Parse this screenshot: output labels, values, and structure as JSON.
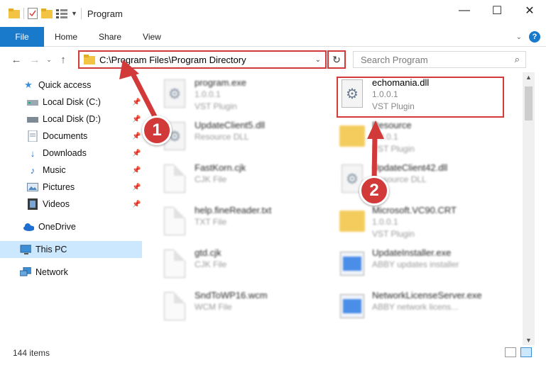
{
  "window": {
    "title": "Program",
    "minimize": "—",
    "maximize": "☐",
    "close": "✕"
  },
  "ribbon": {
    "file": "File",
    "home": "Home",
    "share": "Share",
    "view": "View",
    "help": "?"
  },
  "address": {
    "path": "C:\\Program Files\\Program Directory"
  },
  "search": {
    "placeholder": "Search Program"
  },
  "nav": {
    "items": [
      {
        "label": "Quick access",
        "icon": "star-icon"
      },
      {
        "label": "Local Disk (C:)",
        "icon": "drive-icon"
      },
      {
        "label": "Local Disk (D:)",
        "icon": "drive-icon"
      },
      {
        "label": "Documents",
        "icon": "documents-icon"
      },
      {
        "label": "Downloads",
        "icon": "download-icon"
      },
      {
        "label": "Music",
        "icon": "music-icon"
      },
      {
        "label": "Pictures",
        "icon": "pictures-icon"
      },
      {
        "label": "Videos",
        "icon": "videos-icon"
      },
      {
        "label": "OneDrive",
        "icon": "cloud-icon"
      },
      {
        "label": "This PC",
        "icon": "computer-icon"
      },
      {
        "label": "Network",
        "icon": "network-icon"
      }
    ]
  },
  "files": [
    {
      "name": "program.exe",
      "line2": "1.0.0.1",
      "line3": "VST Plugin"
    },
    {
      "name": "echomania.dll",
      "line2": "1.0.0.1",
      "line3": "VST Plugin"
    },
    {
      "name": "UpdateClient5.dll",
      "line2": "Resource DLL",
      "line3": ""
    },
    {
      "name": "Resource",
      "line2": "1.0.0.1",
      "line3": "VST Plugin"
    },
    {
      "name": "FastKorn.cjk",
      "line2": "CJK File",
      "line3": ""
    },
    {
      "name": "UpdateClient42.dll",
      "line2": "Resource DLL",
      "line3": ""
    },
    {
      "name": "help.fineReader.txt",
      "line2": "TXT File",
      "line3": ""
    },
    {
      "name": "Microsoft.VC90.CRT",
      "line2": "1.0.0.1",
      "line3": "VST Plugin"
    },
    {
      "name": "gtd.cjk",
      "line2": "CJK File",
      "line3": ""
    },
    {
      "name": "UpdateInstaller.exe",
      "line2": "ABBY updates installer",
      "line3": ""
    },
    {
      "name": "SndToWP16.wcm",
      "line2": "WCM File",
      "line3": ""
    },
    {
      "name": "NetworkLicenseServer.exe",
      "line2": "ABBY network licens...",
      "line3": ""
    }
  ],
  "callouts": {
    "one": "1",
    "two": "2"
  },
  "status": {
    "items": "144 items"
  },
  "colors": {
    "accent": "#1979ca",
    "highlight": "#d23a3a",
    "selected": "#cce8ff"
  }
}
